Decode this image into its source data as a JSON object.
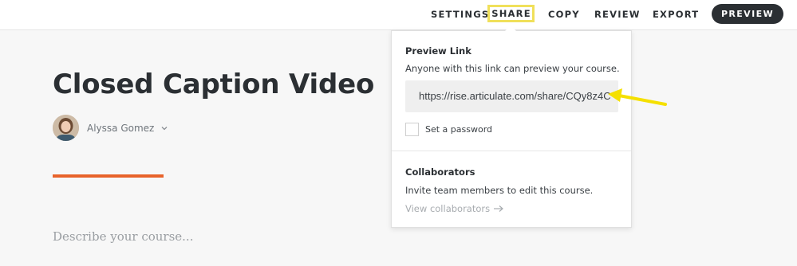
{
  "toolbar": {
    "settings": "SETTINGS",
    "share": "SHARE",
    "copy": "COPY",
    "review": "REVIEW",
    "export": "EXPORT",
    "preview": "PREVIEW"
  },
  "course": {
    "title": "Closed Caption Video",
    "author": "Alyssa Gomez",
    "description_placeholder": "Describe your course..."
  },
  "share_popover": {
    "preview_link_heading": "Preview Link",
    "preview_link_text": "Anyone with this link can preview your course.",
    "link_url": "https://rise.articulate.com/share/CQy8z4C0",
    "set_password_label": "Set a password",
    "password_checked": false,
    "collaborators_heading": "Collaborators",
    "collaborators_text": "Invite team members to edit this course.",
    "view_collaborators": "View collaborators"
  },
  "colors": {
    "accent": "#e8632b",
    "highlight_box": "#f0e05a",
    "annotation_arrow": "#f5e000",
    "dark_button": "#2b2f33"
  }
}
